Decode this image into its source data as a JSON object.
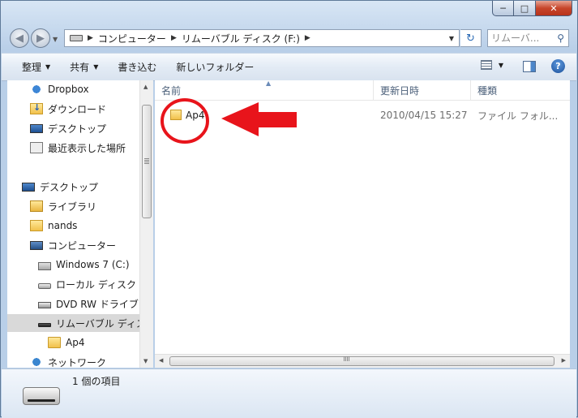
{
  "window": {
    "caption": {
      "minimize": "─",
      "maximize": "□",
      "close": "✕"
    }
  },
  "nav": {
    "back_icon": "back-arrow-icon",
    "forward_icon": "forward-arrow-icon",
    "breadcrumbs": [
      "コンピューター",
      "リムーバブル ディスク (F:)"
    ],
    "search_placeholder": "リムーバ..."
  },
  "toolbar": {
    "organize": "整理",
    "share": "共有",
    "burn": "書き込む",
    "new_folder": "新しいフォルダー"
  },
  "tree": {
    "items": [
      {
        "label": "Dropbox",
        "icon": "dropbox-icon"
      },
      {
        "label": "ダウンロード",
        "icon": "downloads-folder-icon"
      },
      {
        "label": "デスクトップ",
        "icon": "desktop-icon"
      },
      {
        "label": "最近表示した場所",
        "icon": "recent-places-icon"
      },
      {
        "label": "デスクトップ",
        "icon": "desktop-icon"
      },
      {
        "label": "ライブラリ",
        "icon": "library-icon"
      },
      {
        "label": "nands",
        "icon": "user-folder-icon"
      },
      {
        "label": "コンピューター",
        "icon": "computer-icon"
      },
      {
        "label": "Windows 7 (C:)",
        "icon": "windows-drive-icon"
      },
      {
        "label": "ローカル ディスク",
        "icon": "local-disk-icon"
      },
      {
        "label": "DVD RW ドライブ",
        "icon": "dvd-drive-icon"
      },
      {
        "label": "リムーバブル ディス",
        "icon": "removable-disk-icon"
      },
      {
        "label": "Ap4",
        "icon": "folder-icon"
      },
      {
        "label": "ネットワーク",
        "icon": "network-icon"
      }
    ]
  },
  "columns": {
    "name": "名前",
    "date": "更新日時",
    "type": "種類"
  },
  "files": [
    {
      "name": "Ap4",
      "date": "2010/04/15 15:27",
      "type": "ファイル フォル..."
    }
  ],
  "status": {
    "text": "1 個の項目"
  },
  "colors": {
    "annotation_red": "#e8141b",
    "window_frame": "#b9cfe8"
  }
}
